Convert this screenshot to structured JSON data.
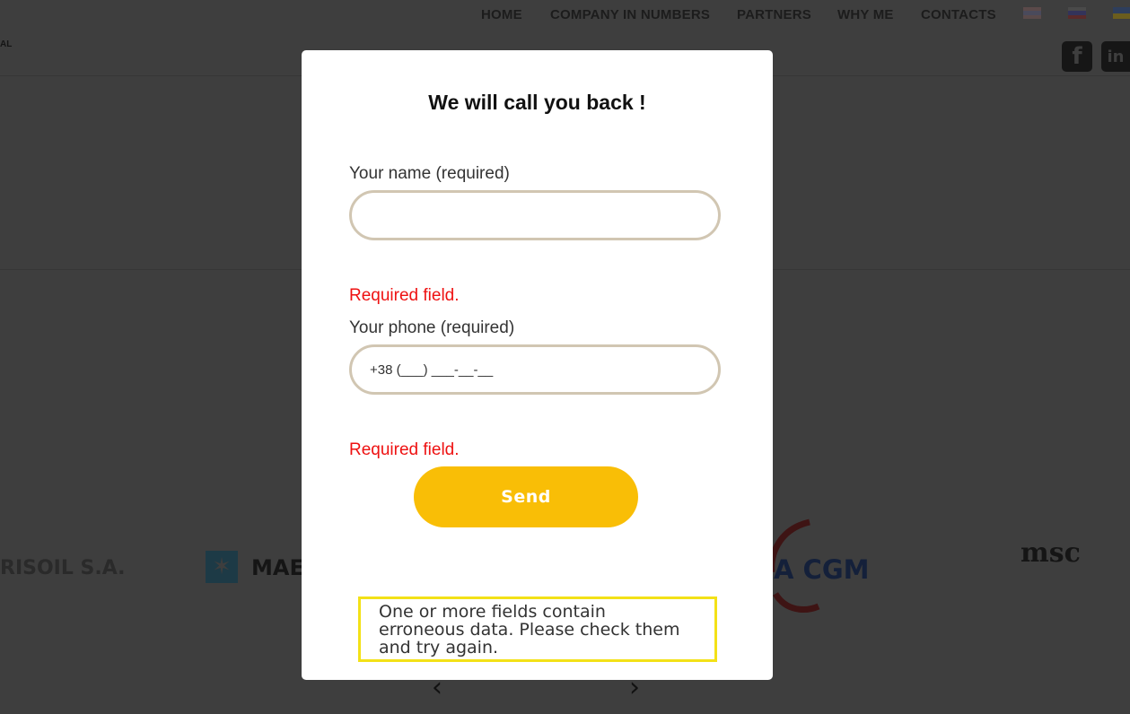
{
  "nav": {
    "items": [
      "HOME",
      "COMPANY IN NUMBERS",
      "PARTNERS",
      "WHY ME",
      "CONTACTS"
    ],
    "flags": [
      "us-flag-icon",
      "ru-flag-icon",
      "ua-flag-icon"
    ]
  },
  "header": {
    "logo_text": "AL",
    "social": [
      "facebook-icon",
      "linkedin-icon"
    ]
  },
  "partners": {
    "items": [
      "RISOIL S.A.",
      "MAE",
      "A CGM",
      "msc"
    ]
  },
  "modal": {
    "title": "We will call you back !",
    "name_label": "Your name (required)",
    "name_value": "",
    "name_error": "Required field.",
    "phone_label": "Your phone (required)",
    "phone_value": "+38 (___) ___-__-__",
    "phone_error": "Required field.",
    "send_label": "Send",
    "response": "One or more fields contain erroneous data. Please check them and try again."
  },
  "carousel": {
    "prev": "‹",
    "next": "›"
  },
  "colors": {
    "overlay": "#3e3e3e",
    "accent": "#f9be06",
    "error": "#ee1111",
    "input_border": "#d1c6b2",
    "response_border": "#f3e117"
  }
}
